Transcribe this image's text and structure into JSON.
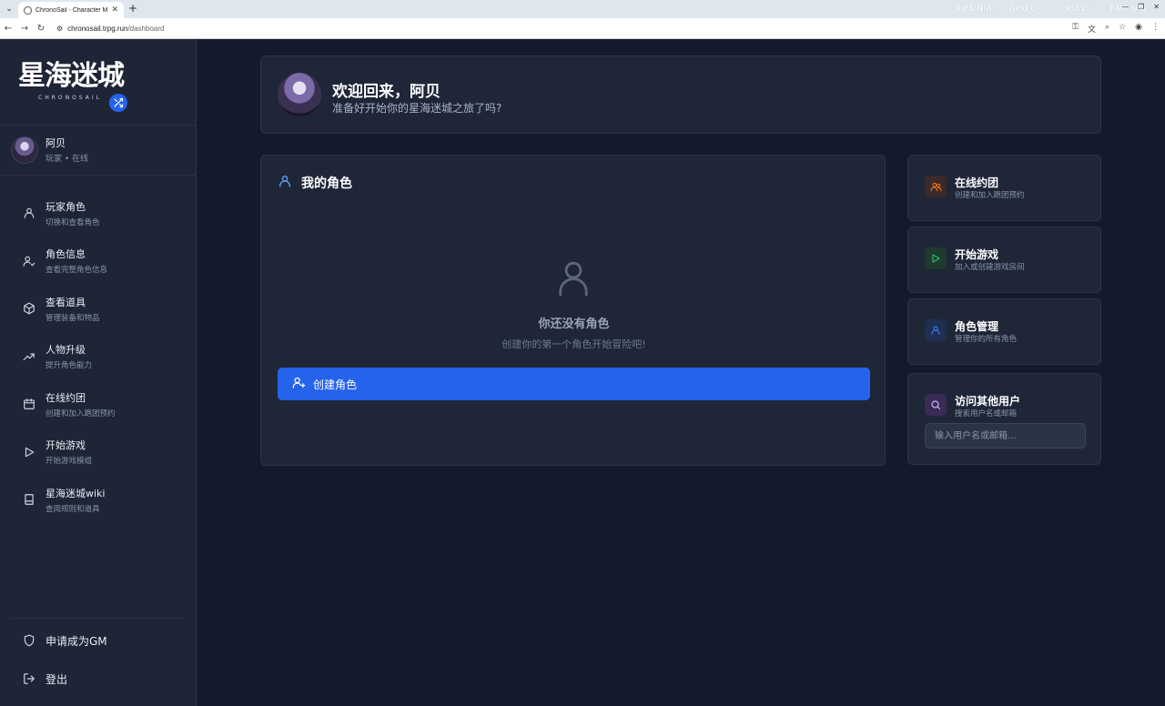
{
  "browser": {
    "tab_title": "ChronoSail - Character Mana",
    "url_host": "chronosail.trpg.run",
    "url_path": "/dashboard",
    "perf": [
      "FPS N/A",
      "GPU 0%",
      "CPU 2%",
      "FMF N/A"
    ]
  },
  "sidebar": {
    "logo_text": "星海迷城",
    "logo_sub": "CHRONOSAIL",
    "user": {
      "name": "阿贝",
      "status": "玩家 • 在线"
    },
    "items": [
      {
        "label": "玩家角色",
        "desc": "切换和查看角色",
        "icon": "user-icon"
      },
      {
        "label": "角色信息",
        "desc": "查看完整角色信息",
        "icon": "user-check-icon"
      },
      {
        "label": "查看道具",
        "desc": "管理装备和物品",
        "icon": "package-icon"
      },
      {
        "label": "人物升级",
        "desc": "提升角色能力",
        "icon": "trending-up-icon"
      },
      {
        "label": "在线约团",
        "desc": "创建和加入跑团预约",
        "icon": "calendar-icon"
      },
      {
        "label": "开始游戏",
        "desc": "开始游戏模组",
        "icon": "play-icon"
      },
      {
        "label": "星海迷城wiki",
        "desc": "查阅规则和道具",
        "icon": "book-icon"
      }
    ],
    "apply_gm": "申请成为GM",
    "logout": "登出"
  },
  "welcome": {
    "title": "欢迎回来，阿贝",
    "subtitle": "准备好开始你的星海迷城之旅了吗?"
  },
  "characters": {
    "title": "我的角色",
    "empty_title": "你还没有角色",
    "empty_sub": "创建你的第一个角色开始冒险吧!",
    "create_label": "创建角色"
  },
  "quick": [
    {
      "title": "在线约团",
      "desc": "创建和加入跑团预约",
      "icon": "users-icon",
      "color": "#f97316"
    },
    {
      "title": "开始游戏",
      "desc": "加入或创建游戏房间",
      "icon": "play-icon",
      "color": "#22c55e"
    },
    {
      "title": "角色管理",
      "desc": "管理你的所有角色",
      "icon": "user-icon",
      "color": "#3b82f6"
    }
  ],
  "visit": {
    "title": "访问其他用户",
    "desc": "搜索用户名或邮箱",
    "placeholder": "输入用户名或邮箱...",
    "color": "#a855f7"
  },
  "colors": {
    "accent": "#2563eb",
    "bg": "#131a2b",
    "card": "#1e2638",
    "sidebar": "#1d2536"
  }
}
